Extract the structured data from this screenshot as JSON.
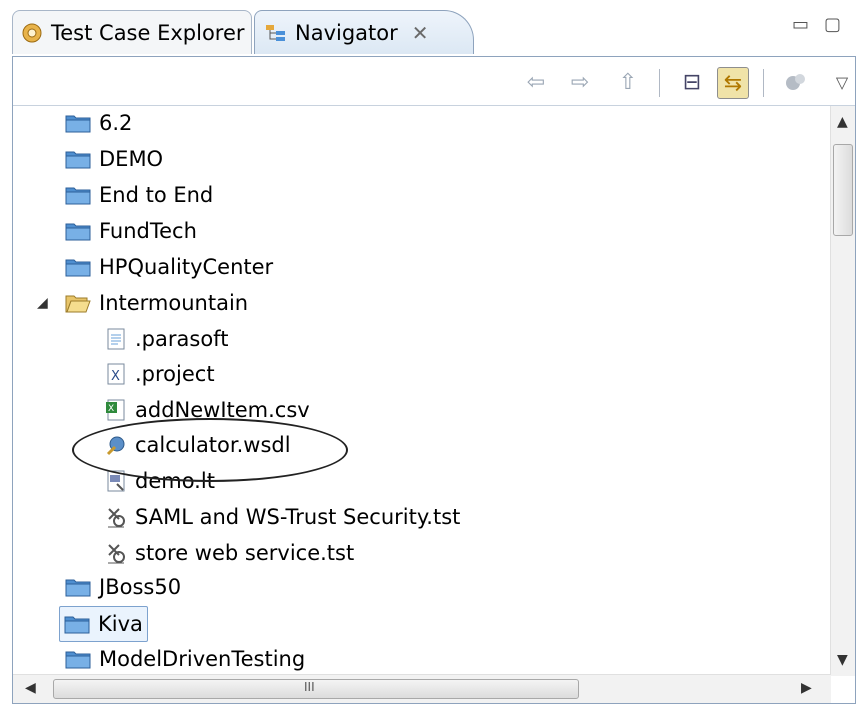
{
  "tabs": [
    {
      "label": "Test Case Explorer",
      "icon": "gear-cluster-icon"
    },
    {
      "label": "Navigator",
      "icon": "navigator-tree-icon",
      "close": "✕"
    }
  ],
  "window_controls": {
    "minimize": "▭",
    "maximize": "▢"
  },
  "toolbar": {
    "back": "⇦",
    "forward": "⇨",
    "up": "⇧",
    "collapse": "⊟",
    "link": "⇆",
    "more": "▽"
  },
  "tree": {
    "items": [
      {
        "label": "6.2",
        "type": "folder"
      },
      {
        "label": "DEMO",
        "type": "folder"
      },
      {
        "label": "End to End",
        "type": "folder"
      },
      {
        "label": "FundTech",
        "type": "folder"
      },
      {
        "label": "HPQualityCenter",
        "type": "folder"
      },
      {
        "label": "Intermountain",
        "type": "folder-open"
      },
      {
        "label": ".parasoft",
        "type": "file-text"
      },
      {
        "label": ".project",
        "type": "file-x"
      },
      {
        "label": "addNewItem.csv",
        "type": "file-csv"
      },
      {
        "label": "calculator.wsdl",
        "type": "file-wsdl"
      },
      {
        "label": "demo.lt",
        "type": "file-lt"
      },
      {
        "label": "SAML and WS-Trust Security.tst",
        "type": "file-tst"
      },
      {
        "label": "store web service.tst",
        "type": "file-tst"
      },
      {
        "label": "JBoss50",
        "type": "folder"
      },
      {
        "label": "Kiva",
        "type": "folder"
      },
      {
        "label": "ModelDrivenTesting",
        "type": "folder"
      }
    ]
  },
  "scroll": {
    "h_grip": "III"
  },
  "colors": {
    "folder": "#4f8fd0",
    "accent": "#f0e3a8",
    "border": "#8ea3bd"
  }
}
